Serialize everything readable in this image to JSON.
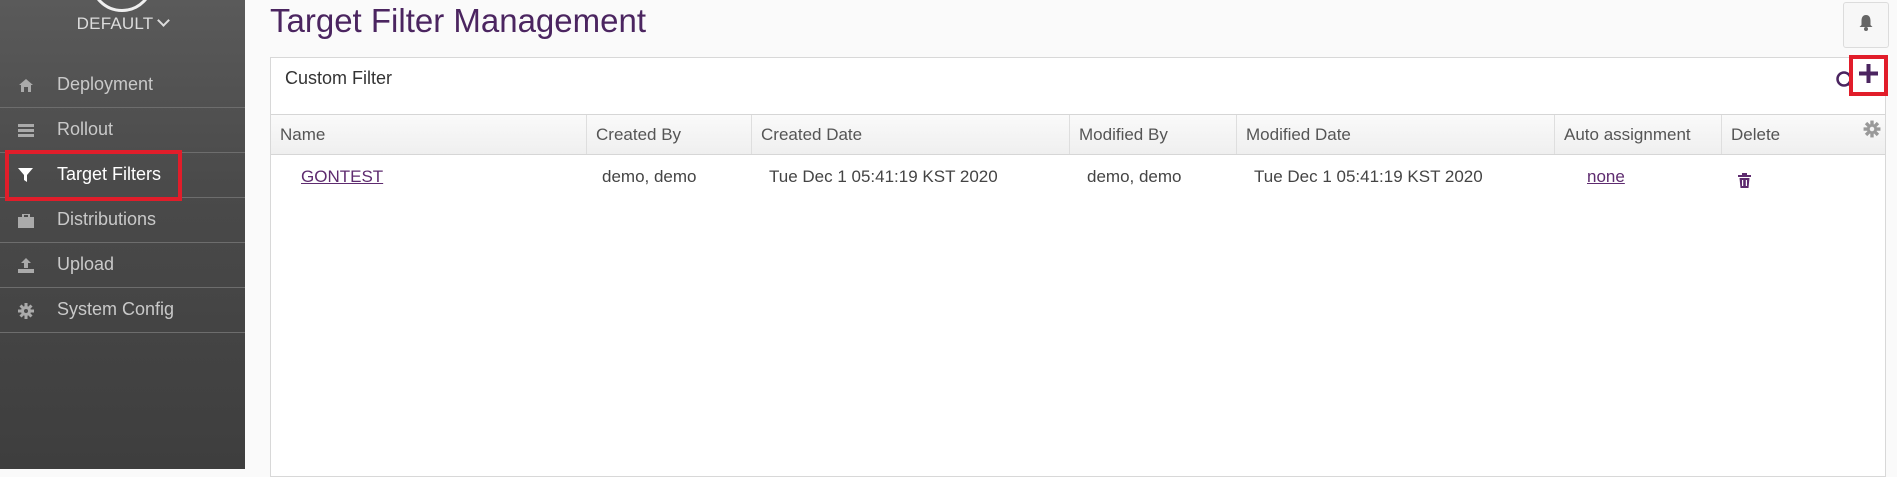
{
  "sidebar": {
    "tenant": "DEFAULT",
    "items": [
      {
        "label": "Deployment",
        "icon": "home-icon"
      },
      {
        "label": "Rollout",
        "icon": "list-icon"
      },
      {
        "label": "Target Filters",
        "icon": "filter-icon"
      },
      {
        "label": "Distributions",
        "icon": "briefcase-icon"
      },
      {
        "label": "Upload",
        "icon": "upload-icon"
      },
      {
        "label": "System Config",
        "icon": "gear-icon"
      }
    ]
  },
  "page": {
    "title": "Target Filter Management"
  },
  "panel": {
    "title": "Custom Filter"
  },
  "table": {
    "columns": [
      "Name",
      "Created By",
      "Created Date",
      "Modified By",
      "Modified Date",
      "Auto assignment",
      "Delete"
    ],
    "rows": [
      {
        "name": "GONTEST",
        "created_by": "demo, demo",
        "created_date": "Tue Dec 1 05:41:19 KST 2020",
        "modified_by": "demo, demo",
        "modified_date": "Tue Dec 1 05:41:19 KST 2020",
        "auto_assignment": "none"
      }
    ]
  },
  "colors": {
    "accent": "#4b2560",
    "highlight": "#e11d2a",
    "sidebar": "#4a4a4a"
  }
}
